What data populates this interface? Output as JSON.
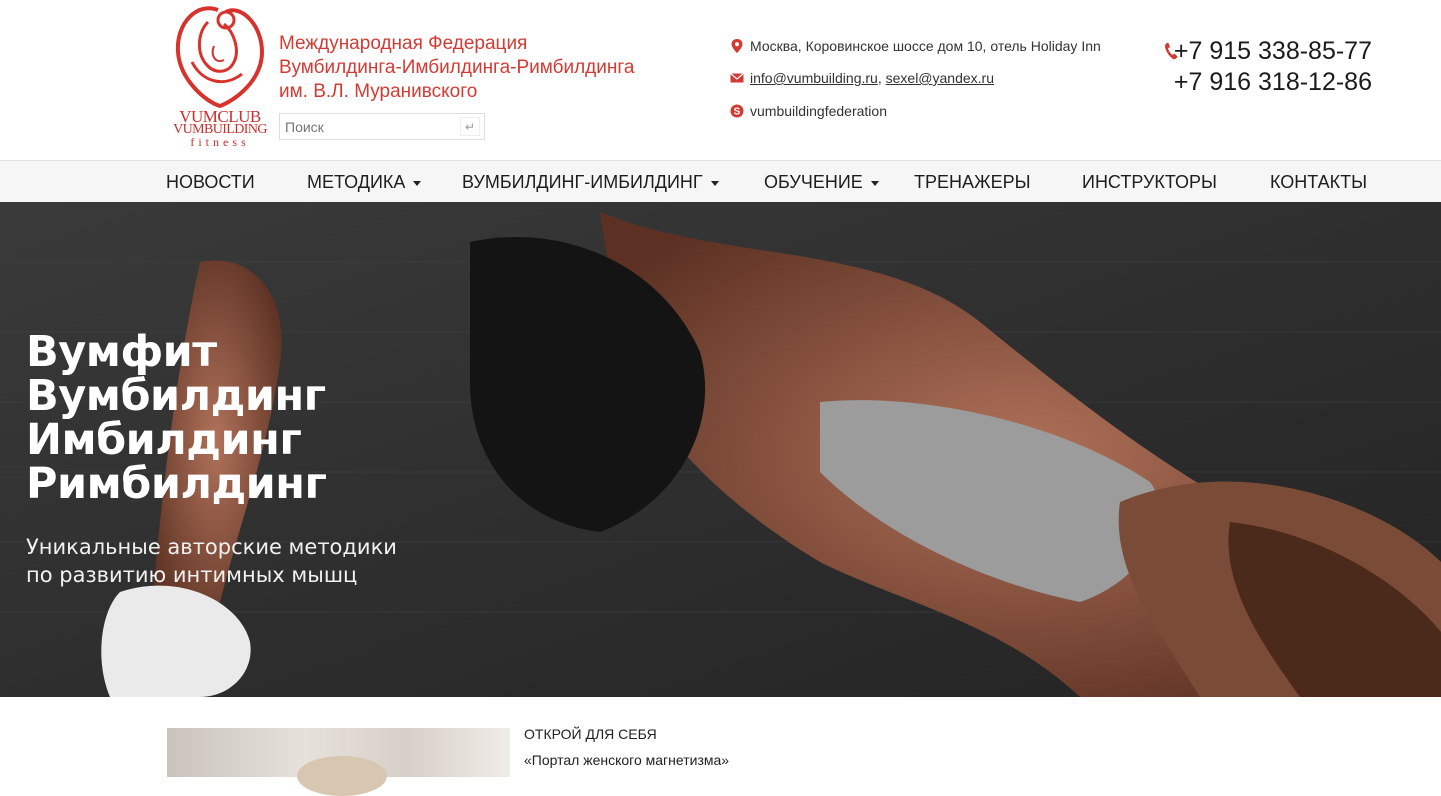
{
  "logo": {
    "line1": "VUMCLUB",
    "line2": "VUMBUILDING",
    "line3": "fitness"
  },
  "org": {
    "line1": "Международная Федерация",
    "line2": "Вумбилдинга-Имбилдинга-Римбилдинга",
    "line3": "им. В.Л. Муранивского"
  },
  "search": {
    "placeholder": "Поиск"
  },
  "contacts": {
    "address": "Москва, Коровинское шоссе дом 10, отель Holiday Inn",
    "email1": "info@vumbuilding.ru",
    "email_sep": ",",
    "email2": "sexel@yandex.ru",
    "skype": "vumbuildingfederation"
  },
  "phones": [
    "+7 915 338-85-77",
    "+7 916 318-12-86"
  ],
  "nav": [
    {
      "label": "НОВОСТИ",
      "dropdown": false
    },
    {
      "label": "МЕТОДИКА",
      "dropdown": true
    },
    {
      "label": "ВУМБИЛДИНГ-ИМБИЛДИНГ",
      "dropdown": true
    },
    {
      "label": "ОБУЧЕНИЕ",
      "dropdown": true
    },
    {
      "label": "ТРЕНАЖЕРЫ",
      "dropdown": false
    },
    {
      "label": "ИНСТРУКТОРЫ",
      "dropdown": false
    },
    {
      "label": "КОНТАКТЫ",
      "dropdown": false
    }
  ],
  "hero": {
    "titles": [
      "Вумфит",
      "Вумбилдинг",
      "Имбилдинг",
      "Римбилдинг"
    ],
    "subtitle1": "Уникальные авторские методики",
    "subtitle2": "по развитию интимных мышц"
  },
  "promo": {
    "kicker": "ОТКРОЙ ДЛЯ СЕБЯ",
    "title": "«Портал женского магнетизма»"
  },
  "colors": {
    "brand_red": "#d23b34",
    "nav_bg": "#f6f6f6",
    "hero_bg": "#2a2a2a"
  },
  "icons": {
    "address": "map-pin-icon",
    "email": "envelope-icon",
    "skype": "skype-icon",
    "phone": "phone-icon"
  }
}
